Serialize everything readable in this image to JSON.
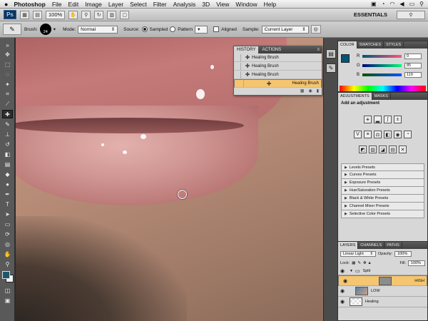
{
  "menubar": {
    "apple": "",
    "app": "Photoshop",
    "items": [
      "File",
      "Edit",
      "Image",
      "Layer",
      "Select",
      "Filter",
      "Analysis",
      "3D",
      "View",
      "Window",
      "Help"
    ]
  },
  "appbar": {
    "logo": "Ps",
    "zoom": "100%",
    "workspace": "ESSENTIALS"
  },
  "options": {
    "brush_label": "Brush:",
    "brush_size": "24",
    "mode_label": "Mode:",
    "mode_value": "Normal",
    "source_label": "Source:",
    "source_sampled": "Sampled",
    "source_pattern": "Pattern",
    "aligned": "Aligned",
    "sample_label": "Sample:",
    "sample_value": "Current Layer"
  },
  "history": {
    "tabs": [
      "HISTORY",
      "ACTIONS"
    ],
    "items": [
      "Healing Brush",
      "Healing Brush",
      "Healing Brush",
      "Healing Brush"
    ],
    "selected_index": 3
  },
  "color": {
    "tabs": [
      "COLOR",
      "SWATCHES",
      "STYLES"
    ],
    "r": "0",
    "g": "85",
    "b": "119",
    "foreground": "#005577"
  },
  "adjustments": {
    "tabs": [
      "ADJUSTMENTS",
      "MASKS"
    ],
    "title": "Add an adjustment",
    "presets": [
      "Levels Presets",
      "Curves Presets",
      "Exposure Presets",
      "Hue/Saturation Presets",
      "Black & White Presets",
      "Channel Mixer Presets",
      "Selective Color Presets"
    ]
  },
  "layers": {
    "tabs": [
      "LAYERS",
      "CHANNELS",
      "PATHS"
    ],
    "blend_mode": "Linear Light",
    "opacity_label": "Opacity:",
    "opacity": "100%",
    "lock_label": "Lock:",
    "fill_label": "Fill:",
    "fill": "100%",
    "group_name": "Split",
    "rows": [
      {
        "name": "HIGH",
        "selected": true
      },
      {
        "name": "LOW",
        "selected": false
      },
      {
        "name": "Healing",
        "selected": false
      }
    ]
  },
  "colors": {
    "selection": "#f5c56f",
    "tools_bg": "#595959"
  }
}
